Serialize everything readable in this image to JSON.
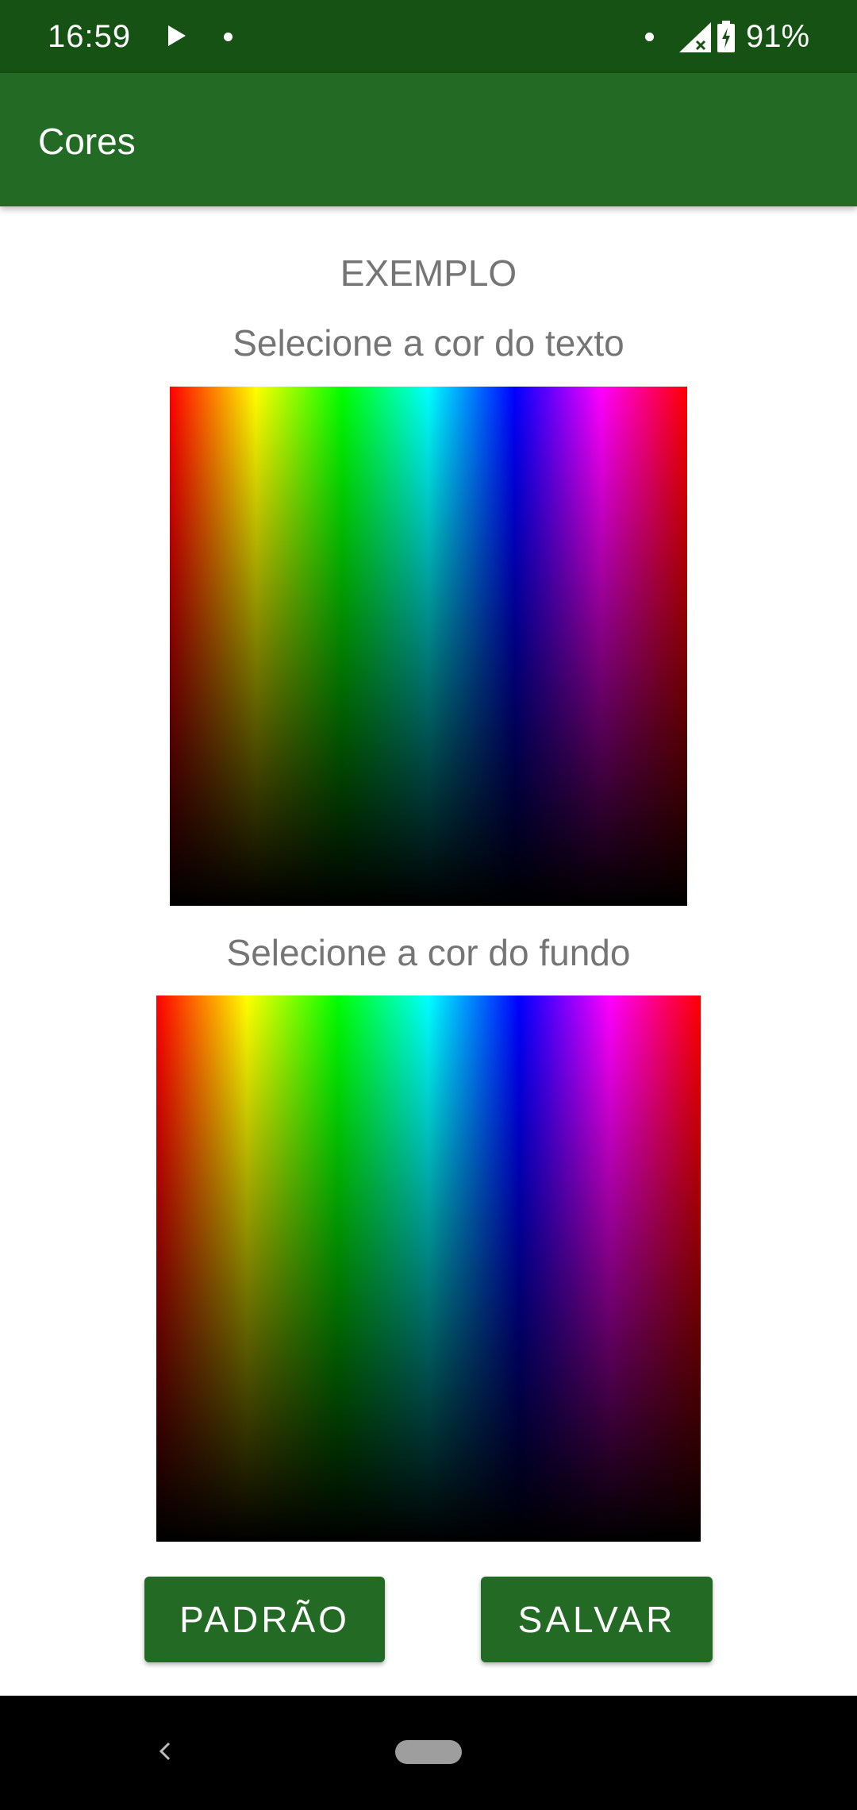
{
  "status_bar": {
    "time": "16:59",
    "battery_percent": "91%",
    "icons": [
      "play-icon",
      "notification-dot-icon",
      "signal-icon",
      "battery-charging-icon"
    ]
  },
  "app_bar": {
    "title": "Cores",
    "color": "#236a25"
  },
  "content": {
    "example_label": "EXEMPLO",
    "text_color_label": "Selecione a cor do texto",
    "background_color_label": "Selecione a cor do fundo"
  },
  "buttons": {
    "default_label": "PADRÃO",
    "save_label": "SALVAR"
  },
  "colors": {
    "status_bar": "#155214",
    "primary": "#236a25",
    "label_text": "#757575"
  },
  "nav_bar": {
    "icons": [
      "back-icon",
      "home-pill-icon"
    ]
  }
}
